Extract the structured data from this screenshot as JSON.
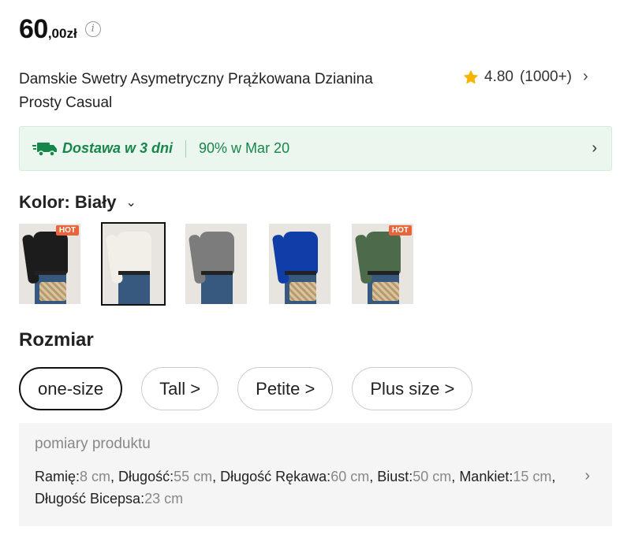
{
  "price": {
    "main": "60",
    "sub": ",00zł",
    "info_icon": "info-icon"
  },
  "product": {
    "title": "Damskie Swetry Asymetryczny Prążkowana Dzianina Prosty Casual",
    "rating": "4.80",
    "rating_count": "(1000+)"
  },
  "shipping": {
    "days": "Dostawa w 3 dni",
    "percent": "90% w Mar 20"
  },
  "color": {
    "label": "Kolor: Biały",
    "swatches": [
      {
        "name": "black",
        "shirt": "#1c1c1c",
        "badge": "HOT",
        "selected": false
      },
      {
        "name": "white",
        "shirt": "#f2efe9",
        "badge": "",
        "selected": true
      },
      {
        "name": "grey",
        "shirt": "#7c7c7c",
        "badge": "",
        "selected": false
      },
      {
        "name": "blue",
        "shirt": "#0f3ea8",
        "badge": "",
        "selected": false
      },
      {
        "name": "green",
        "shirt": "#4d6b4a",
        "badge": "HOT",
        "selected": false
      }
    ]
  },
  "size": {
    "label": "Rozmiar",
    "options": [
      "one-size",
      "Tall >",
      "Petite >",
      "Plus size >"
    ]
  },
  "measurements": {
    "title": "pomiary produktu",
    "items": [
      {
        "k": "Ramię:",
        "v": "8 cm"
      },
      {
        "k": "Długość:",
        "v": "55 cm"
      },
      {
        "k": "Długość Rękawa:",
        "v": "60 cm"
      },
      {
        "k": "Biust:",
        "v": "50 cm"
      },
      {
        "k": "Mankiet:",
        "v": "15 cm"
      },
      {
        "k": "Długość Bicepsa:",
        "v": "23 cm"
      }
    ]
  },
  "colors": {
    "accent_green": "#17864a",
    "hot_badge": "#e8643a",
    "star": "#f5b400"
  }
}
